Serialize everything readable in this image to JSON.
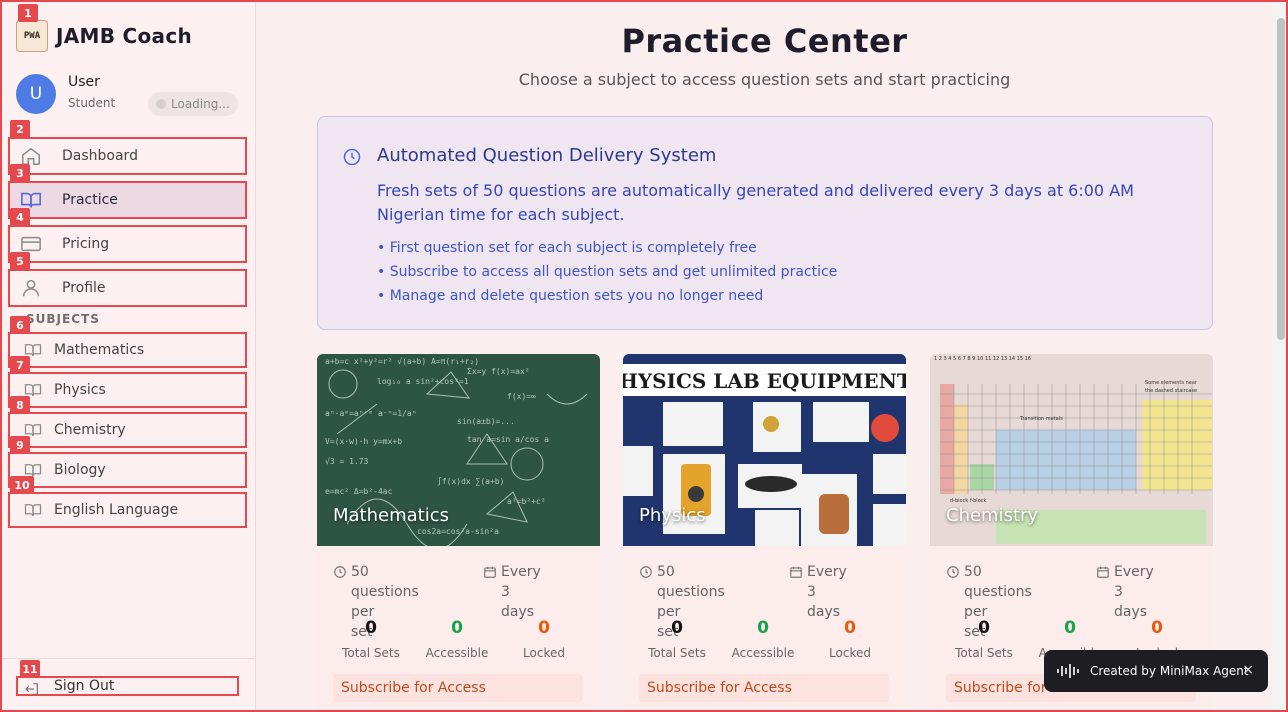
{
  "brand": {
    "title": "JAMB Coach",
    "logo_text": "PWA"
  },
  "user": {
    "initial": "U",
    "name": "User",
    "role": "Student",
    "status": "Loading..."
  },
  "nav": [
    {
      "badge": "2",
      "label": "Dashboard",
      "icon": "home-icon"
    },
    {
      "badge": "3",
      "label": "Practice",
      "icon": "book-open-icon",
      "active": true
    },
    {
      "badge": "4",
      "label": "Pricing",
      "icon": "credit-card-icon"
    },
    {
      "badge": "5",
      "label": "Profile",
      "icon": "user-icon"
    }
  ],
  "subjects_label": "SUBJECTS",
  "subjects": [
    {
      "badge": "6",
      "label": "Mathematics"
    },
    {
      "badge": "7",
      "label": "Physics"
    },
    {
      "badge": "8",
      "label": "Chemistry"
    },
    {
      "badge": "9",
      "label": "Biology"
    },
    {
      "badge": "10",
      "label": "English Language"
    }
  ],
  "signout": {
    "badge": "11",
    "label": "Sign Out"
  },
  "badge_top": "1",
  "page": {
    "title": "Practice Center",
    "subtitle": "Choose a subject to access question sets and start practicing"
  },
  "info": {
    "title": "Automated Question Delivery System",
    "description": "Fresh sets of 50 questions are automatically generated and delivered every 3 days at 6:00 AM Nigerian time for each subject.",
    "bullets": [
      "• First question set for each subject is completely free",
      "• Subscribe to access all question sets and get unlimited practice",
      "• Manage and delete question sets you no longer need"
    ]
  },
  "cards": [
    {
      "name": "Mathematics",
      "per_set": "50 questions per set",
      "per_set_l1": "50 questions per",
      "per_set_l2": "set",
      "freq_l1": "Every 3",
      "freq_l2": "days",
      "total": "0",
      "total_label": "Total Sets",
      "accessible": "0",
      "accessible_label": "Accessible",
      "locked": "0",
      "locked_label": "Locked",
      "cta": "Subscribe for Access"
    },
    {
      "name": "Physics",
      "banner_text": "HYSICS LAB EQUIPMENT",
      "per_set_l1": "50 questions per",
      "per_set_l2": "set",
      "freq_l1": "Every 3",
      "freq_l2": "days",
      "total": "0",
      "total_label": "Total Sets",
      "accessible": "0",
      "accessible_label": "Accessible",
      "locked": "0",
      "locked_label": "Locked",
      "cta": "Subscribe for Access"
    },
    {
      "name": "Chemistry",
      "per_set_l1": "50 questions per",
      "per_set_l2": "set",
      "freq_l1": "Every 3",
      "freq_l2": "days",
      "total": "0",
      "total_label": "Total Sets",
      "accessible": "0",
      "accessible_label": "Accessible",
      "locked": "0",
      "locked_label": "Locked",
      "cta": "Subscribe for Access"
    }
  ],
  "colors": {
    "accent_red": "#e5484d",
    "accessible_green": "#16a34a",
    "locked_orange": "#ea580c",
    "info_blue": "#3647b5"
  },
  "toast": {
    "text": "Created by MiniMax Agent",
    "close": "×"
  }
}
